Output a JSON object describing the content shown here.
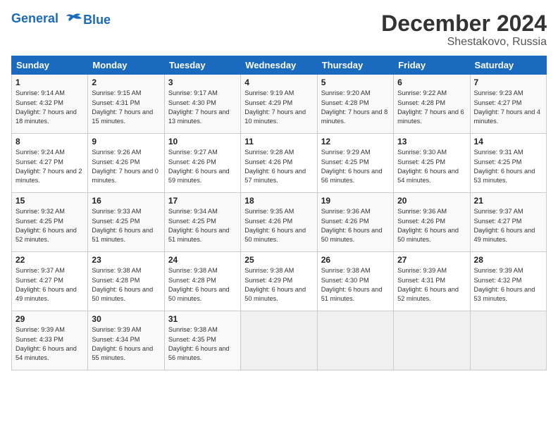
{
  "header": {
    "logo_line1": "General",
    "logo_line2": "Blue",
    "month": "December 2024",
    "location": "Shestakovo, Russia"
  },
  "days_of_week": [
    "Sunday",
    "Monday",
    "Tuesday",
    "Wednesday",
    "Thursday",
    "Friday",
    "Saturday"
  ],
  "weeks": [
    [
      {
        "day": "1",
        "sunrise": "Sunrise: 9:14 AM",
        "sunset": "Sunset: 4:32 PM",
        "daylight": "Daylight: 7 hours and 18 minutes."
      },
      {
        "day": "2",
        "sunrise": "Sunrise: 9:15 AM",
        "sunset": "Sunset: 4:31 PM",
        "daylight": "Daylight: 7 hours and 15 minutes."
      },
      {
        "day": "3",
        "sunrise": "Sunrise: 9:17 AM",
        "sunset": "Sunset: 4:30 PM",
        "daylight": "Daylight: 7 hours and 13 minutes."
      },
      {
        "day": "4",
        "sunrise": "Sunrise: 9:19 AM",
        "sunset": "Sunset: 4:29 PM",
        "daylight": "Daylight: 7 hours and 10 minutes."
      },
      {
        "day": "5",
        "sunrise": "Sunrise: 9:20 AM",
        "sunset": "Sunset: 4:28 PM",
        "daylight": "Daylight: 7 hours and 8 minutes."
      },
      {
        "day": "6",
        "sunrise": "Sunrise: 9:22 AM",
        "sunset": "Sunset: 4:28 PM",
        "daylight": "Daylight: 7 hours and 6 minutes."
      },
      {
        "day": "7",
        "sunrise": "Sunrise: 9:23 AM",
        "sunset": "Sunset: 4:27 PM",
        "daylight": "Daylight: 7 hours and 4 minutes."
      }
    ],
    [
      {
        "day": "8",
        "sunrise": "Sunrise: 9:24 AM",
        "sunset": "Sunset: 4:27 PM",
        "daylight": "Daylight: 7 hours and 2 minutes."
      },
      {
        "day": "9",
        "sunrise": "Sunrise: 9:26 AM",
        "sunset": "Sunset: 4:26 PM",
        "daylight": "Daylight: 7 hours and 0 minutes."
      },
      {
        "day": "10",
        "sunrise": "Sunrise: 9:27 AM",
        "sunset": "Sunset: 4:26 PM",
        "daylight": "Daylight: 6 hours and 59 minutes."
      },
      {
        "day": "11",
        "sunrise": "Sunrise: 9:28 AM",
        "sunset": "Sunset: 4:26 PM",
        "daylight": "Daylight: 6 hours and 57 minutes."
      },
      {
        "day": "12",
        "sunrise": "Sunrise: 9:29 AM",
        "sunset": "Sunset: 4:25 PM",
        "daylight": "Daylight: 6 hours and 56 minutes."
      },
      {
        "day": "13",
        "sunrise": "Sunrise: 9:30 AM",
        "sunset": "Sunset: 4:25 PM",
        "daylight": "Daylight: 6 hours and 54 minutes."
      },
      {
        "day": "14",
        "sunrise": "Sunrise: 9:31 AM",
        "sunset": "Sunset: 4:25 PM",
        "daylight": "Daylight: 6 hours and 53 minutes."
      }
    ],
    [
      {
        "day": "15",
        "sunrise": "Sunrise: 9:32 AM",
        "sunset": "Sunset: 4:25 PM",
        "daylight": "Daylight: 6 hours and 52 minutes."
      },
      {
        "day": "16",
        "sunrise": "Sunrise: 9:33 AM",
        "sunset": "Sunset: 4:25 PM",
        "daylight": "Daylight: 6 hours and 51 minutes."
      },
      {
        "day": "17",
        "sunrise": "Sunrise: 9:34 AM",
        "sunset": "Sunset: 4:25 PM",
        "daylight": "Daylight: 6 hours and 51 minutes."
      },
      {
        "day": "18",
        "sunrise": "Sunrise: 9:35 AM",
        "sunset": "Sunset: 4:26 PM",
        "daylight": "Daylight: 6 hours and 50 minutes."
      },
      {
        "day": "19",
        "sunrise": "Sunrise: 9:36 AM",
        "sunset": "Sunset: 4:26 PM",
        "daylight": "Daylight: 6 hours and 50 minutes."
      },
      {
        "day": "20",
        "sunrise": "Sunrise: 9:36 AM",
        "sunset": "Sunset: 4:26 PM",
        "daylight": "Daylight: 6 hours and 50 minutes."
      },
      {
        "day": "21",
        "sunrise": "Sunrise: 9:37 AM",
        "sunset": "Sunset: 4:27 PM",
        "daylight": "Daylight: 6 hours and 49 minutes."
      }
    ],
    [
      {
        "day": "22",
        "sunrise": "Sunrise: 9:37 AM",
        "sunset": "Sunset: 4:27 PM",
        "daylight": "Daylight: 6 hours and 49 minutes."
      },
      {
        "day": "23",
        "sunrise": "Sunrise: 9:38 AM",
        "sunset": "Sunset: 4:28 PM",
        "daylight": "Daylight: 6 hours and 50 minutes."
      },
      {
        "day": "24",
        "sunrise": "Sunrise: 9:38 AM",
        "sunset": "Sunset: 4:28 PM",
        "daylight": "Daylight: 6 hours and 50 minutes."
      },
      {
        "day": "25",
        "sunrise": "Sunrise: 9:38 AM",
        "sunset": "Sunset: 4:29 PM",
        "daylight": "Daylight: 6 hours and 50 minutes."
      },
      {
        "day": "26",
        "sunrise": "Sunrise: 9:38 AM",
        "sunset": "Sunset: 4:30 PM",
        "daylight": "Daylight: 6 hours and 51 minutes."
      },
      {
        "day": "27",
        "sunrise": "Sunrise: 9:39 AM",
        "sunset": "Sunset: 4:31 PM",
        "daylight": "Daylight: 6 hours and 52 minutes."
      },
      {
        "day": "28",
        "sunrise": "Sunrise: 9:39 AM",
        "sunset": "Sunset: 4:32 PM",
        "daylight": "Daylight: 6 hours and 53 minutes."
      }
    ],
    [
      {
        "day": "29",
        "sunrise": "Sunrise: 9:39 AM",
        "sunset": "Sunset: 4:33 PM",
        "daylight": "Daylight: 6 hours and 54 minutes."
      },
      {
        "day": "30",
        "sunrise": "Sunrise: 9:39 AM",
        "sunset": "Sunset: 4:34 PM",
        "daylight": "Daylight: 6 hours and 55 minutes."
      },
      {
        "day": "31",
        "sunrise": "Sunrise: 9:38 AM",
        "sunset": "Sunset: 4:35 PM",
        "daylight": "Daylight: 6 hours and 56 minutes."
      },
      null,
      null,
      null,
      null
    ]
  ]
}
